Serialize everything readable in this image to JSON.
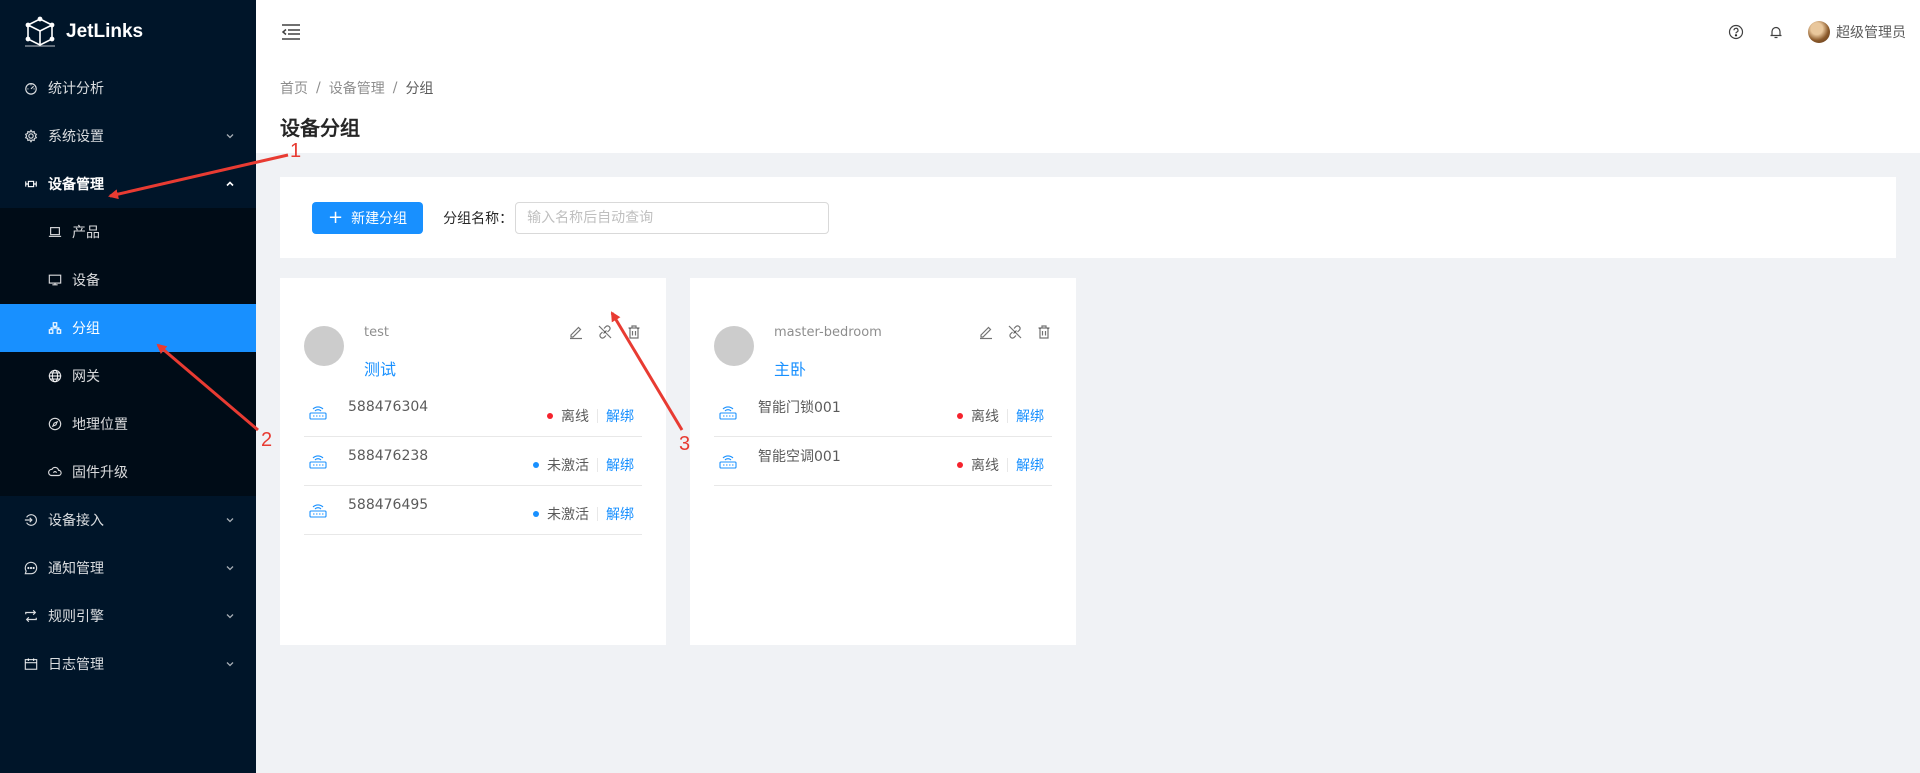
{
  "app": {
    "name": "JetLinks"
  },
  "colors": {
    "primary": "#1890ff",
    "sider": "#001529",
    "offline": "#f5222d",
    "inactive": "#1890ff",
    "annotation": "#e83b32"
  },
  "sidebar": {
    "items": [
      {
        "label": "统计分析",
        "icon": "dashboard-icon"
      },
      {
        "label": "系统设置",
        "icon": "gear-icon"
      },
      {
        "label": "设备管理",
        "icon": "device-manage-icon"
      },
      {
        "label": "设备接入",
        "icon": "login-icon"
      },
      {
        "label": "通知管理",
        "icon": "message-icon"
      },
      {
        "label": "规则引擎",
        "icon": "retweet-icon"
      },
      {
        "label": "日志管理",
        "icon": "calendar-icon"
      }
    ],
    "device_sub": [
      {
        "label": "产品",
        "icon": "laptop-icon"
      },
      {
        "label": "设备",
        "icon": "desktop-icon"
      },
      {
        "label": "分组",
        "icon": "cluster-icon"
      },
      {
        "label": "网关",
        "icon": "global-icon"
      },
      {
        "label": "地理位置",
        "icon": "compass-icon"
      },
      {
        "label": "固件升级",
        "icon": "cloud-sync-icon"
      }
    ]
  },
  "header": {
    "user": "超级管理员"
  },
  "breadcrumb": {
    "home": "首页",
    "parent": "设备管理",
    "current": "分组"
  },
  "page": {
    "title": "设备分组"
  },
  "search": {
    "new_button": "新建分组",
    "label": "分组名称：",
    "placeholder": "输入名称后自动查询"
  },
  "groups": [
    {
      "id": "test",
      "name": "测试",
      "devices": [
        {
          "name": "588476304",
          "status": "离线",
          "action": "解绑"
        },
        {
          "name": "588476238",
          "status": "未激活",
          "action": "解绑"
        },
        {
          "name": "588476495",
          "status": "未激活",
          "action": "解绑"
        }
      ]
    },
    {
      "id": "master-bedroom",
      "name": "主卧",
      "devices": [
        {
          "name": "智能门锁001",
          "status": "离线",
          "action": "解绑"
        },
        {
          "name": "智能空调001",
          "status": "离线",
          "action": "解绑"
        }
      ]
    }
  ],
  "annotations": {
    "a1": "1",
    "a2": "2",
    "a3": "3"
  }
}
